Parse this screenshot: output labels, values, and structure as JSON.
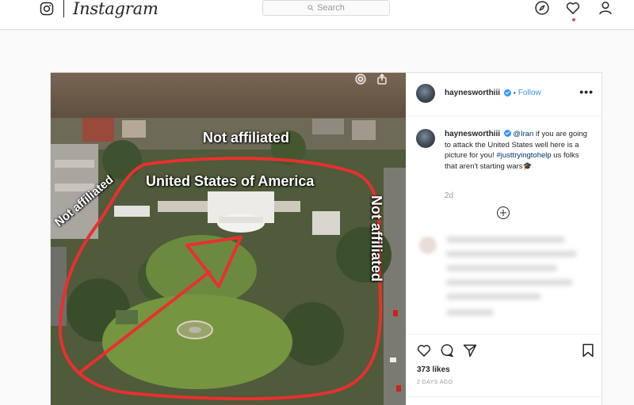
{
  "nav": {
    "brand": "Instagram",
    "search_placeholder": "Search",
    "icons": [
      "instagram-icon",
      "compass-icon",
      "heart-icon",
      "profile-icon"
    ]
  },
  "photo": {
    "annotations": {
      "top": "Not affiliated",
      "center": "United States of America",
      "left": "Not affiliated",
      "right": "Not affiliated"
    },
    "annotation_color": "#e8302f"
  },
  "post": {
    "username": "haynesworthiii",
    "separator": "•",
    "follow_label": "Follow",
    "more_label": "•••",
    "caption": {
      "username": "haynesworthiii",
      "mention": "@Iran",
      "text_before_tag": " if you are going to attack the United States well here is a picture for you! ",
      "hashtag": "#justtryingtohelp",
      "text_after_tag": " us folks that aren't starting wars🎓"
    },
    "caption_time": "2d",
    "likes": "373 likes",
    "posted_ago": "2 DAYS AGO"
  },
  "colors": {
    "link_blue": "#3897f0",
    "hashtag_blue": "#003569",
    "notification_red": "#ed4956"
  }
}
